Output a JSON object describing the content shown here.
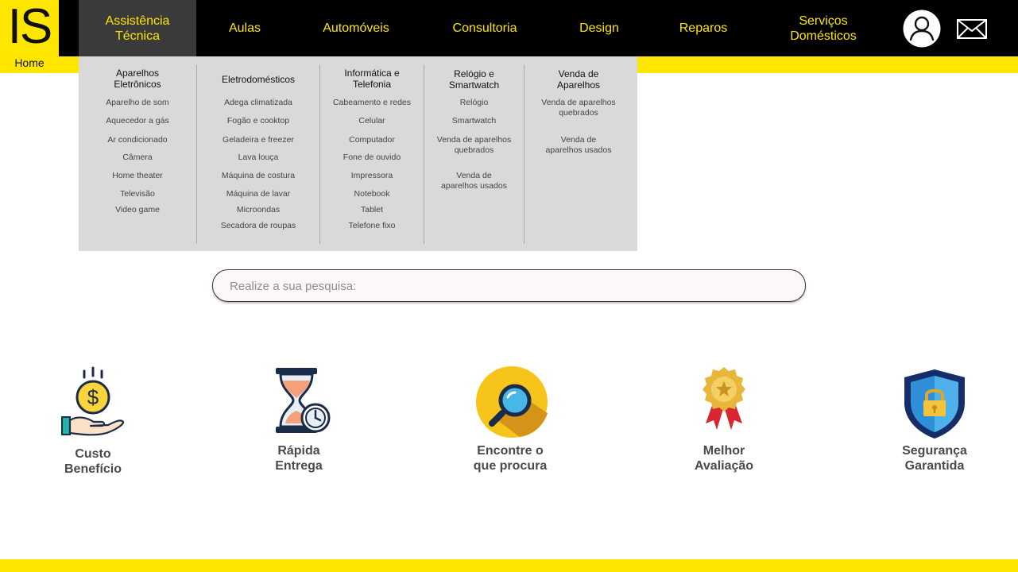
{
  "logo": {
    "text": "IS",
    "home_label": "Home"
  },
  "nav": [
    {
      "label_line1": "Assistência",
      "label_line2": "Técnica"
    },
    {
      "label_line1": "Aulas",
      "label_line2": ""
    },
    {
      "label_line1": "Automóveis",
      "label_line2": ""
    },
    {
      "label_line1": "Consultoria",
      "label_line2": ""
    },
    {
      "label_line1": "Design",
      "label_line2": ""
    },
    {
      "label_line1": "Reparos",
      "label_line2": ""
    },
    {
      "label_line1": "Serviços",
      "label_line2": "Domésticos"
    }
  ],
  "header_icons": {
    "profile": "user-profile-icon",
    "mail": "mail-icon"
  },
  "dropdown": {
    "columns": [
      {
        "title1": "Aparelhos",
        "title2": "Eletrônicos",
        "items": [
          "Aparelho de som",
          "Aquecedor a gás",
          "Ar condicionado",
          "Câmera",
          "Home theater",
          "Televisão",
          "Video game"
        ]
      },
      {
        "title1": "Eletrodomésticos",
        "title2": "",
        "items": [
          "Adega climatizada",
          "Fogão e cooktop",
          "Geladeira e freezer",
          "Lava louça",
          "Máquina de costura",
          "Máquina de lavar",
          "Microondas",
          "Secadora de roupas"
        ]
      },
      {
        "title1": "Informática e",
        "title2": "Telefonia",
        "items": [
          "Cabeamento e redes",
          "Celular",
          "Computador",
          "Fone de ouvido",
          "Impressora",
          "Notebook",
          "Tablet",
          "Telefone fixo"
        ]
      },
      {
        "title1": "Relógio e",
        "title2": "Smartwatch",
        "items": [
          "Relógio",
          "Smartwatch",
          "Venda de aparelhos|quebrados",
          "Venda de|aparelhos usados"
        ]
      },
      {
        "title1": "Venda de",
        "title2": "Aparelhos",
        "items": [
          "Venda de aparelhos|quebrados",
          "Venda de|aparelhos usados"
        ]
      }
    ]
  },
  "search": {
    "placeholder": "Realize a sua pesquisa:",
    "value": ""
  },
  "features": [
    {
      "line1": "Custo",
      "line2": "Benefício",
      "icon": "money-hand-icon"
    },
    {
      "line1": "Rápida",
      "line2": "Entrega",
      "icon": "hourglass-clock-icon"
    },
    {
      "line1": "Encontre o",
      "line2": "que procura",
      "icon": "magnifier-icon"
    },
    {
      "line1": "Melhor",
      "line2": "Avaliação",
      "icon": "award-medal-icon"
    },
    {
      "line1": "Segurança",
      "line2": "Garantida",
      "icon": "security-shield-icon"
    }
  ],
  "colors": {
    "brand_yellow": "#ffe600",
    "topbar": "#000000",
    "active_nav": "#3a3a3a",
    "dropdown_bg": "#d9d9d9"
  }
}
